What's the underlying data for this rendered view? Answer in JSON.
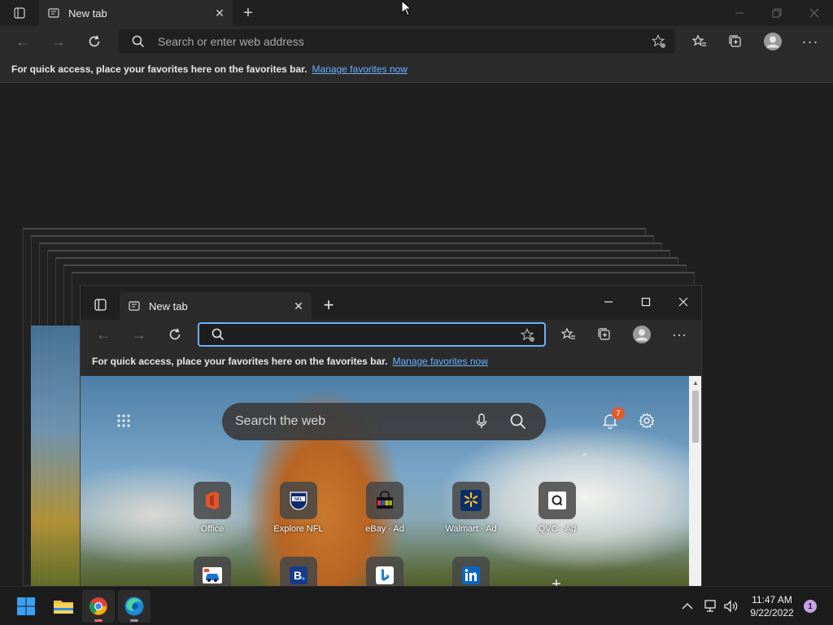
{
  "outer": {
    "tab_title": "New tab",
    "address_placeholder": "Search or enter web address",
    "favorites_text": "For quick access, place your favorites here on the favorites bar.",
    "favorites_link": "Manage favorites now"
  },
  "inner": {
    "tab_title": "New tab",
    "favorites_text": "For quick access, place your favorites here on the favorites bar.",
    "favorites_link": "Manage favorites now",
    "search_placeholder": "Search the web",
    "notification_count": "7",
    "quick_links": [
      {
        "label": "Office",
        "ad": ""
      },
      {
        "label": "Explore NFL",
        "ad": ""
      },
      {
        "label": "eBay",
        "ad": "· Ad"
      },
      {
        "label": "Walmart",
        "ad": "· Ad"
      },
      {
        "label": "QVC",
        "ad": "· Ad"
      }
    ]
  },
  "taskbar": {
    "time": "11:47 AM",
    "date": "9/22/2022",
    "notification_badge": "1"
  },
  "colors": {
    "accent": "#6ab0ff",
    "badge": "#e05a2b",
    "notification_badge": "#c8a2e8"
  }
}
